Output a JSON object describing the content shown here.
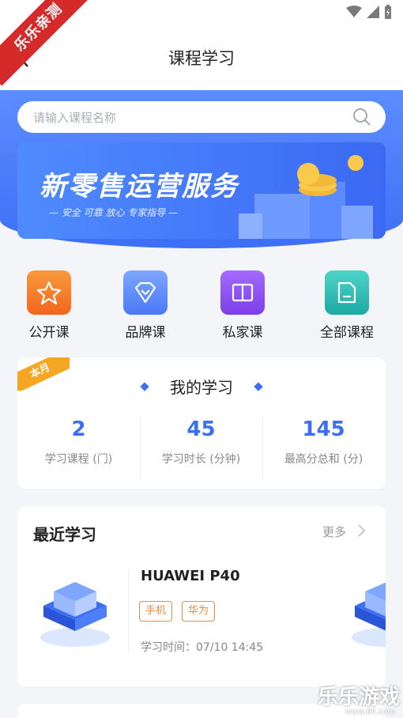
{
  "header": {
    "title": "课程学习",
    "ribbon": "乐乐亲测"
  },
  "search": {
    "placeholder": "请输入课程名称"
  },
  "banner": {
    "title": "新零售运营服务",
    "subtitle": "— 安全 可靠 放心 专家指导 —"
  },
  "categories": [
    {
      "label": "公开课",
      "icon": "star-icon",
      "color": "#f5731f"
    },
    {
      "label": "品牌课",
      "icon": "heart-tag-icon",
      "color": "#5b8cff"
    },
    {
      "label": "私家课",
      "icon": "book-icon",
      "color": "#8b4df0"
    },
    {
      "label": "全部课程",
      "icon": "folder-icon",
      "color": "#26b6b0"
    }
  ],
  "study": {
    "tag": "本月",
    "title": "我的学习",
    "stats": [
      {
        "value": "2",
        "label": "学习课程 (门)"
      },
      {
        "value": "45",
        "label": "学习时长 (分钟)"
      },
      {
        "value": "145",
        "label": "最高分总和 (分)"
      }
    ]
  },
  "recent": {
    "title": "最近学习",
    "more": "更多",
    "course": {
      "name": "HUAWEI P40",
      "tags": [
        "手机",
        "华为"
      ],
      "time": "学习时间：07/10 14:45"
    }
  },
  "watermark": {
    "main": "乐乐游戏",
    "sub": "www.6ll.com"
  },
  "colors": {
    "primary": "#3d6ff5",
    "accent": "#f08a3c"
  }
}
